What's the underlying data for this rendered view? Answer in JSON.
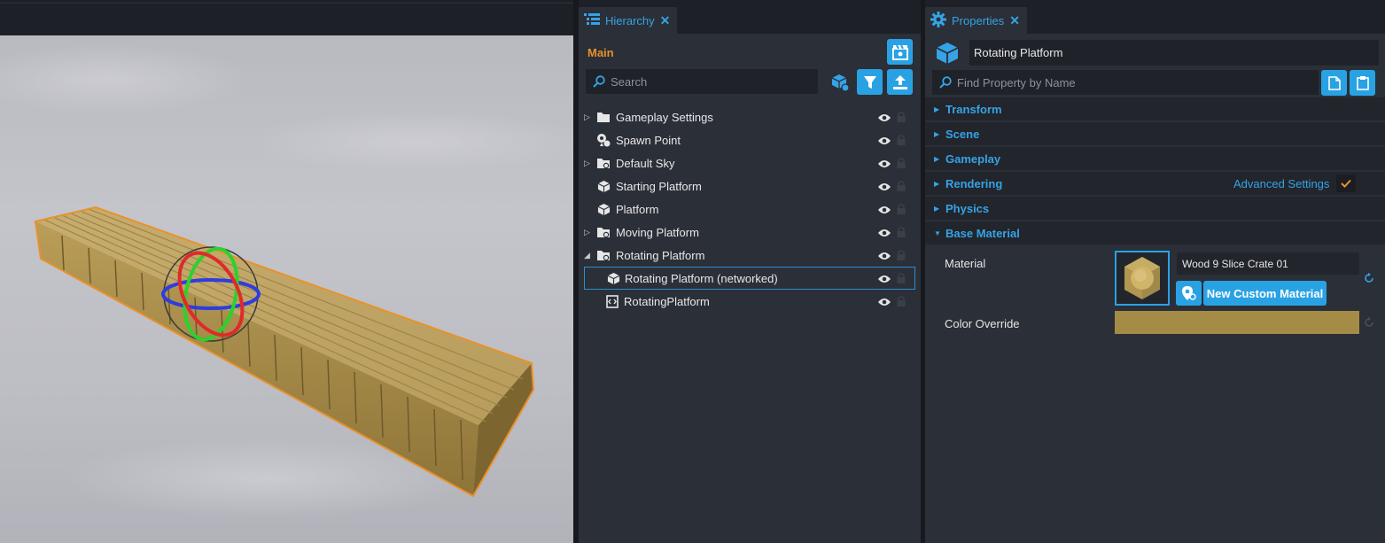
{
  "hierarchy": {
    "tab_label": "Hierarchy",
    "main_label": "Main",
    "search_placeholder": "Search",
    "items": [
      {
        "label": "Gameplay Settings",
        "icon": "folder-icon",
        "expander": "collapsed",
        "depth": 0
      },
      {
        "label": "Spawn Point",
        "icon": "spawn-point-icon",
        "expander": "none",
        "depth": 0
      },
      {
        "label": "Default Sky",
        "icon": "folder-gear-icon",
        "expander": "collapsed",
        "depth": 0
      },
      {
        "label": "Starting Platform",
        "icon": "cube-icon",
        "expander": "none",
        "depth": 0
      },
      {
        "label": "Platform",
        "icon": "cube-icon",
        "expander": "none",
        "depth": 0
      },
      {
        "label": "Moving Platform",
        "icon": "folder-gear-icon",
        "expander": "collapsed",
        "depth": 0
      },
      {
        "label": "Rotating Platform",
        "icon": "folder-gear-icon",
        "expander": "expanded",
        "depth": 0
      },
      {
        "label": "Rotating Platform (networked)",
        "icon": "cube-icon",
        "expander": "none",
        "depth": 1,
        "selected": true
      },
      {
        "label": "RotatingPlatform",
        "icon": "script-icon",
        "expander": "none",
        "depth": 1
      }
    ]
  },
  "properties": {
    "tab_label": "Properties",
    "object_name": "Rotating Platform",
    "find_placeholder": "Find Property by Name",
    "sections": [
      {
        "title": "Transform",
        "expanded": false
      },
      {
        "title": "Scene",
        "expanded": false
      },
      {
        "title": "Gameplay",
        "expanded": false
      },
      {
        "title": "Rendering",
        "expanded": false
      },
      {
        "title": "Physics",
        "expanded": false
      },
      {
        "title": "Base Material",
        "expanded": true
      }
    ],
    "advanced_settings_label": "Advanced Settings",
    "advanced_settings_checked": true,
    "material_label": "Material",
    "material_value": "Wood 9 Slice Crate 01",
    "new_material_label": "New Custom Material",
    "color_override_label": "Color Override",
    "color_override_value": "#a48b46"
  },
  "colors": {
    "accent": "#29a2e4",
    "main_label": "#e8922a",
    "selection_outline": "#e8922a",
    "panel_bg": "#2b2f37"
  }
}
